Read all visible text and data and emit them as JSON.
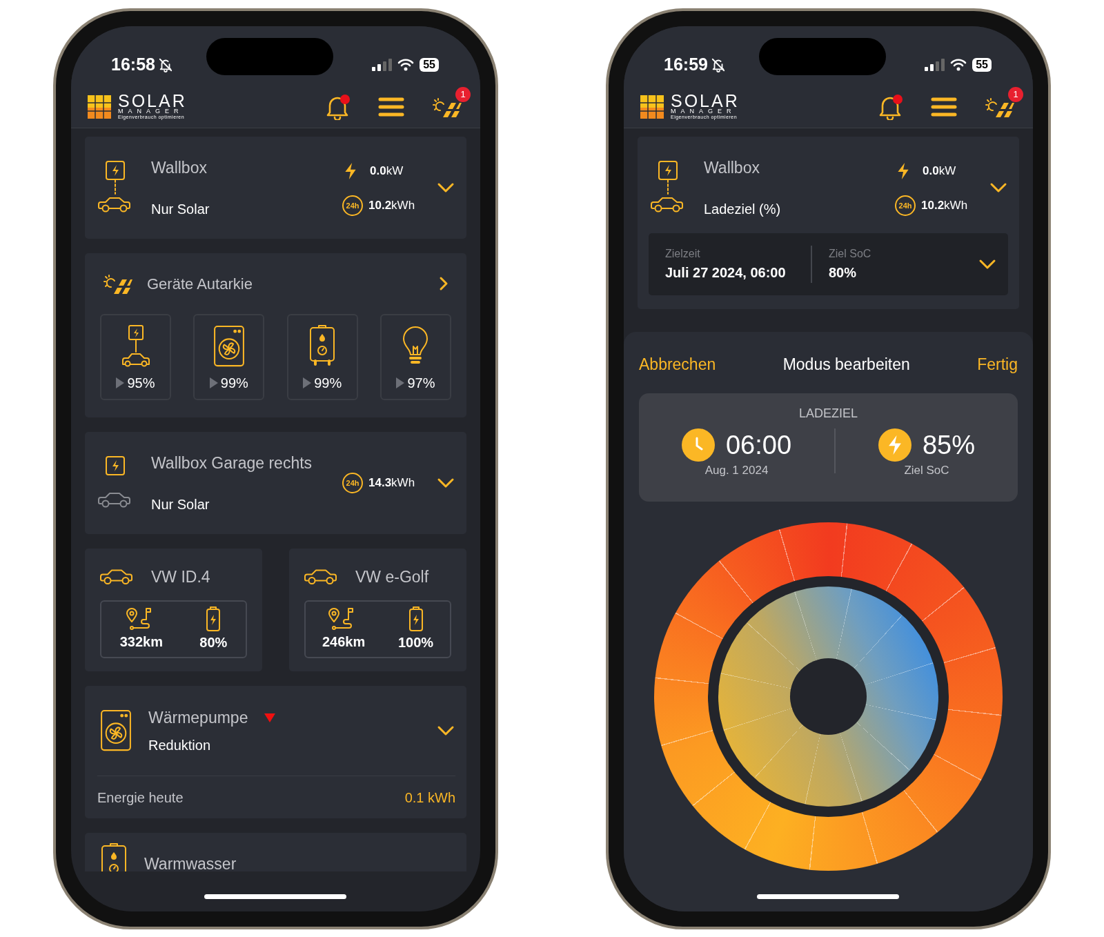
{
  "phones": [
    {
      "status_bar": {
        "time": "16:58",
        "muted": true,
        "battery": "55"
      },
      "header": {
        "logo": {
          "word": "SOLAR",
          "sub": "MANAGER",
          "tagline": "Eigenverbrauch optimieren"
        },
        "bell_dot": true,
        "badge": "1"
      },
      "cards": [
        {
          "kind": "wallbox",
          "title": "Wallbox",
          "mode": "Nur Solar",
          "connected": true,
          "power": "**0.0**kW",
          "period": "24h",
          "energy": "**10.2**kWh"
        },
        {
          "kind": "autarkie",
          "title": "Geräte Autarkie",
          "devices": [
            {
              "kind": "wallbox",
              "value": "95%"
            },
            {
              "kind": "heatpump",
              "value": "99%"
            },
            {
              "kind": "boiler",
              "value": "99%"
            },
            {
              "kind": "light",
              "value": "97%"
            }
          ]
        },
        {
          "kind": "wallbox",
          "title": "Wallbox Garage rechts",
          "mode": "Nur Solar",
          "connected": false,
          "period": "24h",
          "energy": "**14.3**kWh"
        },
        {
          "kind": "cars",
          "cars": [
            {
              "name": "VW ID.4",
              "range": "332km",
              "soc": "80%"
            },
            {
              "name": "VW e-Golf",
              "range": "246km",
              "soc": "100%"
            }
          ]
        },
        {
          "kind": "heatpump",
          "title": "Wärmepumpe",
          "declining": true,
          "status": "Reduktion",
          "energy_label": "Energie heute",
          "energy": "0.1 kWh"
        },
        {
          "kind": "boiler",
          "title": "Warmwasser"
        }
      ]
    },
    {
      "status_bar": {
        "time": "16:59",
        "muted": true,
        "battery": "55"
      },
      "header": {
        "logo": {
          "word": "SOLAR",
          "sub": "MANAGER",
          "tagline": "Eigenverbrauch optimieren"
        },
        "bell_dot": true,
        "badge": "1"
      },
      "cards": [
        {
          "kind": "wallbox",
          "title": "Wallbox",
          "mode": "Ladeziel (%)",
          "connected": true,
          "power": "**0.0**kW",
          "period": "24h",
          "energy": "**10.2**kWh",
          "target": {
            "time_label": "Zielzeit",
            "time": "Juli 27 2024, 06:00",
            "soc_label": "Ziel SoC",
            "soc": "80%"
          }
        }
      ],
      "sheet": {
        "cancel": "Abbrechen",
        "title": "Modus bearbeiten",
        "done": "Fertig",
        "goal": {
          "heading": "LADEZIEL",
          "time": "06:00",
          "date": "Aug. 1 2024",
          "soc": "85%",
          "soc_label": "Ziel SoC"
        }
      }
    }
  ]
}
